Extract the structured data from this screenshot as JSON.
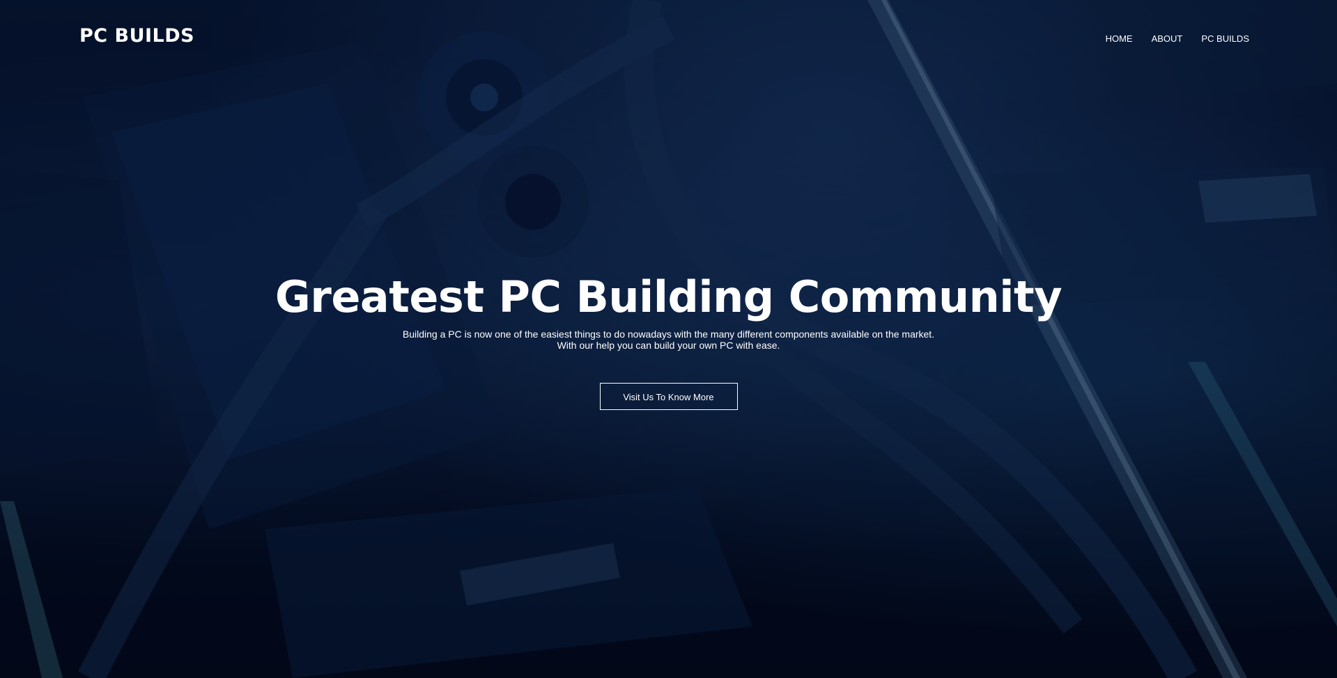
{
  "nav": {
    "logo": "PC BUILDS",
    "links": [
      {
        "label": "HOME"
      },
      {
        "label": "ABOUT"
      },
      {
        "label": "PC BUILDS"
      }
    ]
  },
  "hero": {
    "title": "Greatest PC Building Community",
    "subtitle_line1": "Building a PC is now one of the easiest things to do nowadays with the many different components available on the market.",
    "subtitle_line2": "With our help you can build your own PC with ease.",
    "cta_label": "Visit Us To Know More"
  },
  "colors": {
    "background": "#050f2a",
    "text": "#ffffff",
    "accent": "#2a6fb0"
  }
}
